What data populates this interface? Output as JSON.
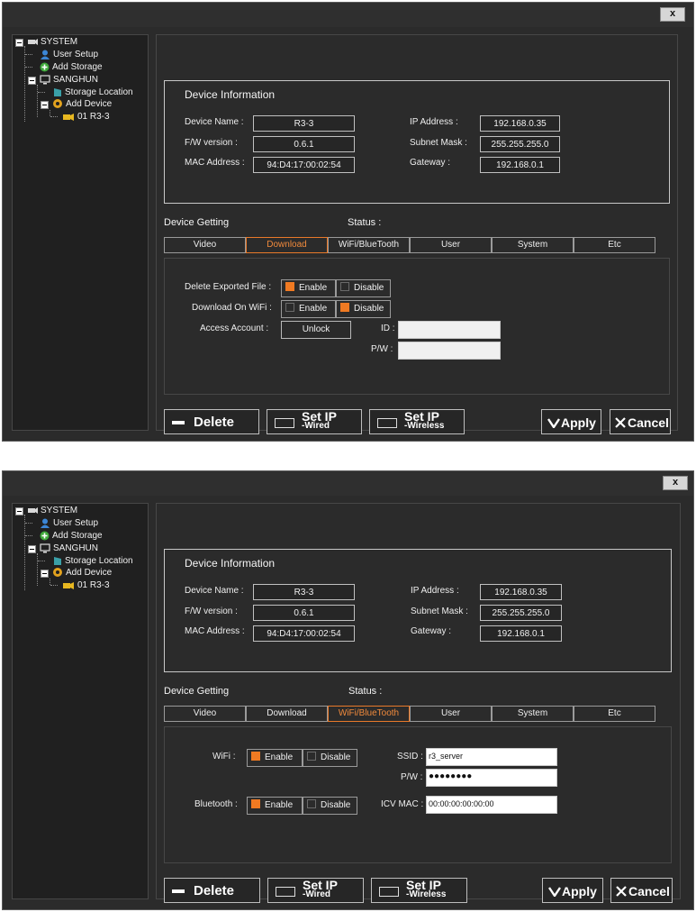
{
  "close_label": "x",
  "colors": {
    "accent": "#f07a22",
    "background": "#2b2b2b",
    "panel": "#202020"
  },
  "tree": {
    "items": [
      {
        "label": "SYSTEM",
        "icon": "camera-icon"
      },
      {
        "label": "User Setup",
        "icon": "user-icon"
      },
      {
        "label": "Add Storage",
        "icon": "add-icon"
      },
      {
        "label": "SANGHUN",
        "icon": "monitor-icon"
      },
      {
        "label": "Storage Location",
        "icon": "storage-icon"
      },
      {
        "label": "Add Device",
        "icon": "gear-icon"
      },
      {
        "label": "01 R3-3",
        "icon": "camera-device-icon"
      }
    ]
  },
  "device_info": {
    "title": "Device Information",
    "device_name_label": "Device Name :",
    "device_name": "R3-3",
    "fw_label": "F/W version :",
    "fw": "0.6.1",
    "mac_label": "MAC Address :",
    "mac": "94:D4:17:00:02:54",
    "ip_label": "IP Address :",
    "ip": "192.168.0.35",
    "subnet_label": "Subnet Mask :",
    "subnet": "255.255.255.0",
    "gateway_label": "Gateway :",
    "gateway": "192.168.0.1"
  },
  "device_setting_label": "Device Getting",
  "status_label": "Status :",
  "tabs": [
    "Video",
    "Download",
    "WiFi/BlueTooth",
    "User",
    "System",
    "Etc"
  ],
  "download_panel": {
    "delete_exported_label": "Delete Exported File :",
    "download_wifi_label": "Download On WiFi :",
    "access_account_label": "Access Account :",
    "enable": "Enable",
    "disable": "Disable",
    "unlock": "Unlock",
    "id_label": "ID :",
    "pw_label": "P/W :"
  },
  "wifi_panel": {
    "wifi_label": "WiFi :",
    "bluetooth_label": "Bluetooth :",
    "enable": "Enable",
    "disable": "Disable",
    "ssid_label": "SSID :",
    "ssid": "r3_server",
    "pw_label": "P/W :",
    "pw": "●●●●●●●●",
    "icv_mac_label": "ICV MAC :",
    "icv_mac": "00:00:00:00:00:00"
  },
  "buttons": {
    "delete": "Delete",
    "set_ip": "Set IP",
    "wired": "-Wired",
    "wireless": "-Wireless",
    "apply": "Apply",
    "cancel": "Cancel"
  }
}
